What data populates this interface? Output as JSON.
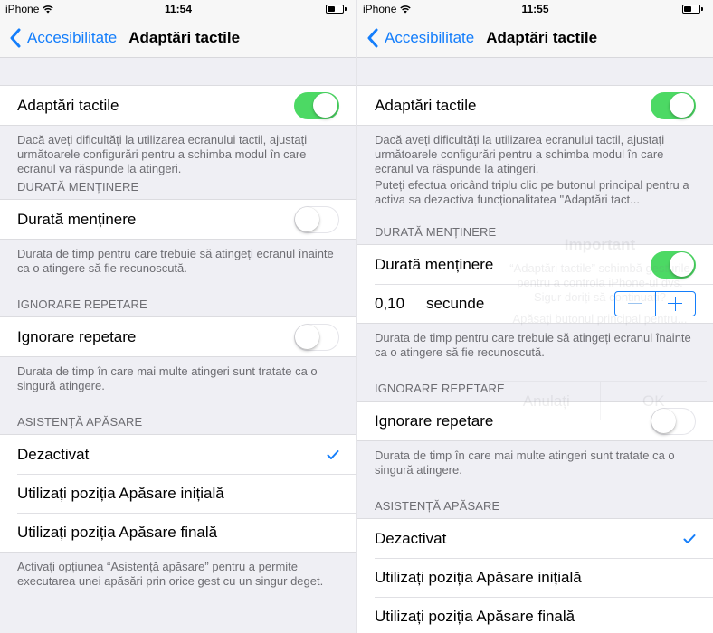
{
  "colors": {
    "accent": "#147efb",
    "toggle_on": "#4cd964",
    "background": "#efeff4",
    "footer_text": "#6d6d72"
  },
  "left": {
    "status": {
      "carrier": "iPhone",
      "time": "11:54",
      "battery_level": 0.45
    },
    "nav": {
      "back_label": "Accesibilitate",
      "title": "Adaptări tactile"
    },
    "main_toggle": {
      "label": "Adaptări tactile",
      "on": true
    },
    "main_footer": "Dacă aveți dificultăți la utilizarea ecranului tactil, ajustați următoarele configurări pentru a schimba modul în care ecranul va răspunde la atingeri.",
    "hold": {
      "header": "DURATĂ MENȚINERE",
      "label": "Durată menținere",
      "on": false,
      "footer": "Durata de timp pentru care trebuie să atingeți ecranul înainte ca o atingere să fie recunoscută."
    },
    "ignore": {
      "header": "IGNORARE REPETARE",
      "label": "Ignorare repetare",
      "on": false,
      "footer": "Durata de timp în care mai multe atingeri sunt tratate ca o singură atingere."
    },
    "tap": {
      "header": "ASISTENȚĂ APĂSARE",
      "options": [
        {
          "label": "Dezactivat",
          "selected": true
        },
        {
          "label": "Utilizați poziția Apăsare inițială",
          "selected": false
        },
        {
          "label": "Utilizați poziția Apăsare finală",
          "selected": false
        }
      ],
      "footer": "Activați opțiunea “Asistență apăsare” pentru a permite executarea unei apăsări prin orice gest cu un singur deget."
    }
  },
  "right": {
    "status": {
      "carrier": "iPhone",
      "time": "11:55",
      "battery_level": 0.45
    },
    "nav": {
      "back_label": "Accesibilitate",
      "title": "Adaptări tactile"
    },
    "main_toggle": {
      "label": "Adaptări tactile",
      "on": true
    },
    "main_footer": "Dacă aveți dificultăți la utilizarea ecranului tactil, ajustați următoarele configurări pentru a schimba modul în care ecranul va răspunde la atingeri.",
    "main_footer_2": "Puteți efectua oricând triplu clic pe butonul principal pentru a activa sa dezactiva funcționalitatea \"Adaptări tact...",
    "hold": {
      "header": "DURATĂ MENȚINERE",
      "label": "Durată menținere",
      "on": true,
      "value": "0,10",
      "unit": "secunde",
      "footer": "Durata de timp pentru care trebuie să atingeți ecranul înainte ca o atingere să fie recunoscută."
    },
    "ignore": {
      "header": "IGNORARE REPETARE",
      "label": "Ignorare repetare",
      "on": false,
      "footer": "Durata de timp în care mai multe atingeri sunt tratate ca o singură atingere."
    },
    "tap": {
      "header": "ASISTENȚĂ APĂSARE",
      "options": [
        {
          "label": "Dezactivat",
          "selected": true
        },
        {
          "label": "Utilizați poziția Apăsare inițială",
          "selected": false
        },
        {
          "label": "Utilizați poziția Apăsare finală",
          "selected": false
        }
      ]
    },
    "ghost_alert": {
      "title": "Important",
      "body": "“Adaptări tactile” schimbă gesturile pentru a controla iPhone-ul dvs. Sigur doriți să continuați?",
      "hint": "Apăsați butonul principal pentru...",
      "cancel": "Anulați",
      "ok": "OK"
    }
  }
}
